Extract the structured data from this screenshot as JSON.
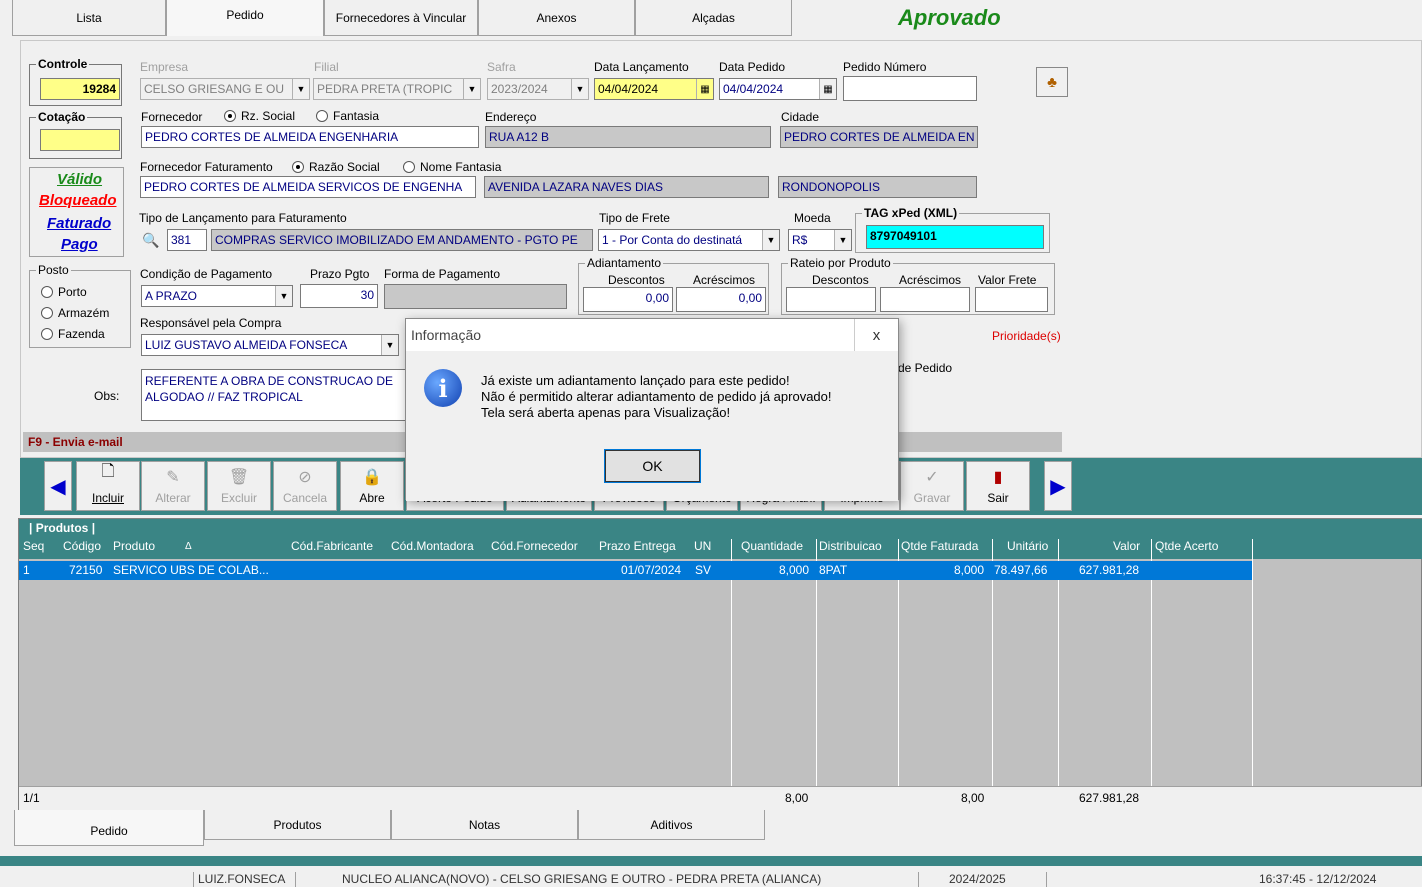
{
  "top_tabs": [
    "Lista",
    "Pedido",
    "Fornecedores à Vincular",
    "Anexos",
    "Alçadas"
  ],
  "status": "Aprovado",
  "colors": {
    "approved": "#1a8a1a",
    "teal": "#3a8585",
    "selected": "#0078d7",
    "yellow": "#ffff88",
    "cyan": "#00ffff",
    "valido": "#1a8a1a",
    "bloqueado": "#ff0000",
    "faturado": "#0000cc",
    "pago": "#0000cc",
    "prioridade": "#dd0000"
  },
  "controle": {
    "label": "Controle",
    "value": "19284"
  },
  "cotacao": {
    "label": "Cotação",
    "value": ""
  },
  "empresa": {
    "label": "Empresa",
    "value": "CELSO GRIESANG E OU"
  },
  "filial": {
    "label": "Filial",
    "value": "PEDRA PRETA (TROPIC"
  },
  "safra": {
    "label": "Safra",
    "value": "2023/2024"
  },
  "data_lancamento": {
    "label": "Data Lançamento",
    "value": "04/04/2024"
  },
  "data_pedido": {
    "label": "Data Pedido",
    "value": "04/04/2024"
  },
  "pedido_numero": {
    "label": "Pedido Número",
    "value": ""
  },
  "fornecedor": {
    "label": "Fornecedor",
    "opt1": "Rz. Social",
    "opt2": "Fantasia",
    "value": "PEDRO CORTES DE ALMEIDA ENGENHARIA"
  },
  "endereco": {
    "label": "Endereço",
    "value": "RUA A12 B"
  },
  "cidade": {
    "label": "Cidade",
    "value": "PEDRO CORTES DE ALMEIDA EN"
  },
  "status_links": [
    "Válido",
    "Bloqueado",
    "Faturado",
    "Pago"
  ],
  "fornecedor_faturamento": {
    "label": "Fornecedor Faturamento",
    "opt1": "Razão Social",
    "opt2": "Nome Fantasia",
    "value": "PEDRO CORTES DE ALMEIDA SERVICOS DE ENGENHA",
    "endereco": "AVENIDA LAZARA NAVES DIAS",
    "cidade": "RONDONOPOLIS"
  },
  "tipo_lancamento": {
    "label": "Tipo de Lançamento para Faturamento",
    "code": "381",
    "value": "COMPRAS SERVICO IMOBILIZADO EM ANDAMENTO - PGTO PE"
  },
  "tipo_frete": {
    "label": "Tipo de Frete",
    "value": "1 - Por Conta do destinatá"
  },
  "moeda": {
    "label": "Moeda",
    "value": "R$"
  },
  "tag_xped": {
    "label": "TAG xPed (XML)",
    "value": "8797049101"
  },
  "posto": {
    "label": "Posto",
    "options": [
      "Porto",
      "Armazém",
      "Fazenda"
    ]
  },
  "condicao_pagamento": {
    "label": "Condição de Pagamento",
    "value": "A PRAZO"
  },
  "prazo_pgto": {
    "label": "Prazo Pgto",
    "value": "30"
  },
  "forma_pagamento": {
    "label": "Forma de Pagamento",
    "value": ""
  },
  "adiantamento": {
    "label": "Adiantamento",
    "descontos_label": "Descontos",
    "acrescimos_label": "Acréscimos",
    "descontos": "0,00",
    "acrescimos": "0,00"
  },
  "rateio": {
    "label": "Rateio por Produto",
    "descontos_label": "Descontos",
    "acrescimos_label": "Acréscimos",
    "frete_label": "Valor Frete"
  },
  "responsavel": {
    "label": "Responsável pela Compra",
    "value": "LUIZ GUSTAVO ALMEIDA FONSECA"
  },
  "prioridade": "Prioridade(s)",
  "de_pedido": "de Pedido",
  "obs": {
    "label": "Obs:",
    "line1": "REFERENTE A OBRA DE CONSTRUCAO DE",
    "line2": "ALGODAO  // FAZ TROPICAL"
  },
  "f9": "F9 - Envia e-mail",
  "toolbar": {
    "incluir": "Incluir",
    "alterar": "Alterar",
    "excluir": "Excluir",
    "cancela": "Cancela",
    "abre": "Abre",
    "acerto": "Acerto Pedido",
    "adiantamento": "Adiantamento",
    "previsoes": "Previsões",
    "orcamento": "Orçamento",
    "regra": "Regra Finan.",
    "imprime": "Imprime",
    "gravar": "Gravar",
    "sair": "Sair"
  },
  "produtos": {
    "title": "| Produtos |",
    "columns": [
      "Seq",
      "Código",
      "Produto",
      "Cód.Fabricante",
      "Cód.Montadora",
      "Cód.Fornecedor",
      "Prazo Entrega",
      "UN",
      "Quantidade",
      "Distribuicao",
      "Qtde Faturada",
      "Unitário",
      "Valor",
      "Qtde Acerto"
    ],
    "sort_icon": "Δ",
    "rows": [
      {
        "seq": "1",
        "codigo": "72150",
        "produto": "SERVICO UBS DE COLAB...",
        "prazo": "01/07/2024",
        "un": "SV",
        "quantidade": "8,000",
        "distribuicao": "8PAT",
        "faturada": "8,000",
        "unitario": "78.497,66",
        "valor": "627.981,28"
      }
    ],
    "footer": {
      "page": "1/1",
      "quantidade": "8,00",
      "faturada": "8,00",
      "valor": "627.981,28"
    }
  },
  "bottom_tabs": [
    "Pedido",
    "Produtos",
    "Notas",
    "Aditivos"
  ],
  "statusbar": {
    "user": "LUIZ.FONSECA",
    "company": "NUCLEO ALIANCA(NOVO) - CELSO GRIESANG E OUTRO - PEDRA PRETA (ALIANCA)",
    "safra": "2024/2025",
    "datetime": "16:37:45 - 12/12/2024"
  },
  "dialog": {
    "title": "Informação",
    "close": "x",
    "line1": "Já existe um adiantamento lançado para este pedido!",
    "line2": "Não é permitido alterar adiantamento de pedido já aprovado!",
    "line3": "Tela será aberta apenas para Visualização!",
    "ok": "OK"
  }
}
